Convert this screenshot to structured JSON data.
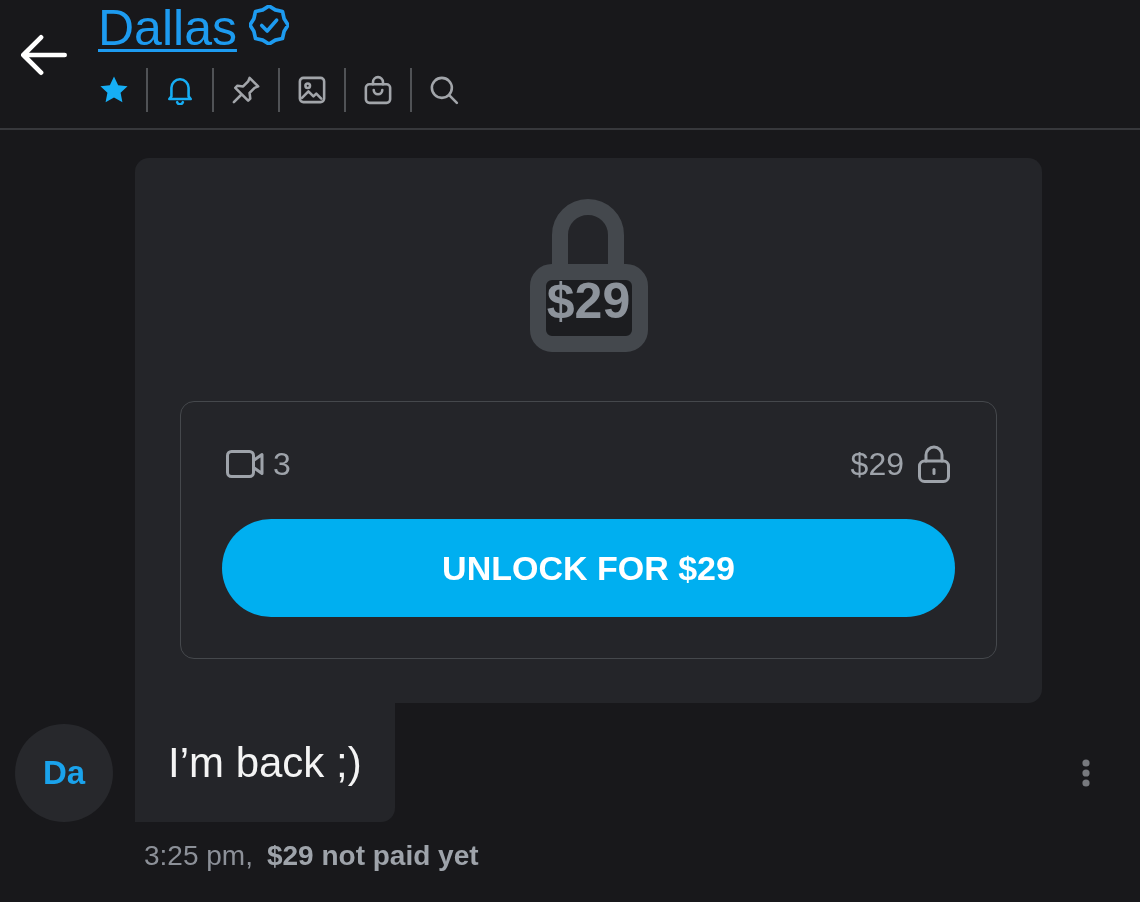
{
  "header": {
    "title": "Dallas",
    "verified": true,
    "tools": [
      {
        "kind": "star",
        "on": true
      },
      {
        "kind": "bell",
        "on": true
      },
      {
        "kind": "pin",
        "on": false
      },
      {
        "kind": "image",
        "on": false
      },
      {
        "kind": "bag",
        "on": false
      },
      {
        "kind": "search",
        "on": false
      }
    ]
  },
  "message": {
    "locked_price": "$29",
    "media": {
      "video_count": "3",
      "price": "$29"
    },
    "unlock_button": "UNLOCK FOR $29",
    "avatar": "Da",
    "text": "I’m back ;)",
    "time": "3:25 pm,",
    "payment_status": "$29 not paid yet"
  }
}
